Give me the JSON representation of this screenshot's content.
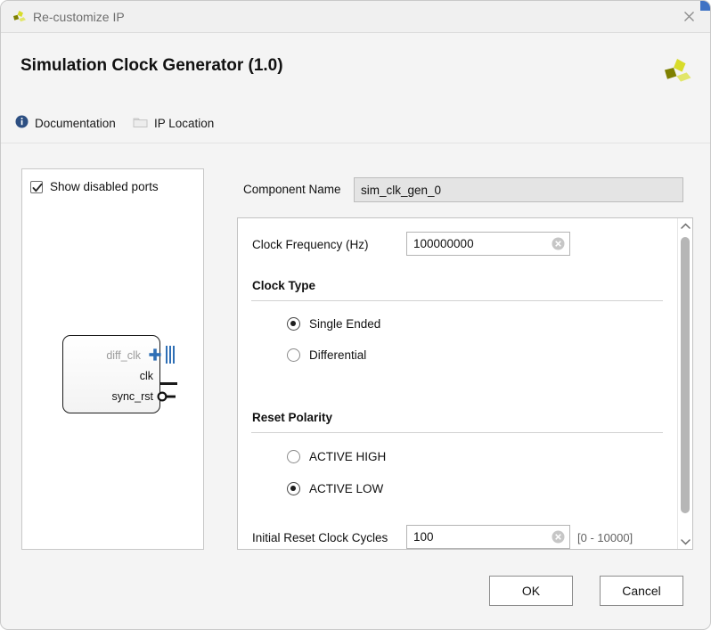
{
  "window": {
    "title": "Re-customize IP",
    "logo_icon": "xilinx-logo-icon",
    "close_icon": "close-icon"
  },
  "header": {
    "title": "Simulation Clock Generator (1.0)",
    "logo_icon": "xilinx-logo-icon"
  },
  "linkbar": {
    "documentation": {
      "label": "Documentation",
      "icon": "info-icon"
    },
    "ip_location": {
      "label": "IP Location",
      "icon": "folder-icon"
    }
  },
  "preview": {
    "show_disabled_ports": {
      "label": "Show disabled ports",
      "checked": true
    },
    "block": {
      "ports": [
        {
          "name": "diff_clk",
          "disabled": true,
          "marker": "bus-expand",
          "expander_icon": "plus-icon"
        },
        {
          "name": "clk",
          "disabled": false,
          "marker": "signal"
        },
        {
          "name": "sync_rst",
          "disabled": false,
          "marker": "inverted-signal"
        }
      ]
    }
  },
  "component_name": {
    "label": "Component Name",
    "value": "sim_clk_gen_0",
    "placeholder": "",
    "readonly": true
  },
  "options": {
    "clock_frequency": {
      "label": "Clock Frequency (Hz)",
      "value": "100000000",
      "placeholder": "",
      "clear_icon": "clear-circle-icon"
    },
    "clock_type": {
      "heading": "Clock Type",
      "options": [
        {
          "label": "Single Ended",
          "selected": true
        },
        {
          "label": "Differential",
          "selected": false
        }
      ]
    },
    "reset_polarity": {
      "heading": "Reset Polarity",
      "options": [
        {
          "label": "ACTIVE HIGH",
          "selected": false
        },
        {
          "label": "ACTIVE LOW",
          "selected": true
        }
      ]
    },
    "initial_reset_clock_cycles": {
      "label": "Initial Reset Clock Cycles",
      "value": "100",
      "placeholder": "",
      "range_hint": "[0 - 10000]",
      "clear_icon": "clear-circle-icon"
    },
    "scrollbar": {
      "up_icon": "chevron-up-icon",
      "down_icon": "chevron-down-icon"
    }
  },
  "footer": {
    "ok_label": "OK",
    "cancel_label": "Cancel"
  },
  "colors": {
    "accent_blue": "#3f72c4",
    "logo_olive": "#7e8000",
    "logo_yellow": "#d8dc2a",
    "bus_blue": "#2f6fb5",
    "dialog_bg": "#f4f4f4"
  }
}
